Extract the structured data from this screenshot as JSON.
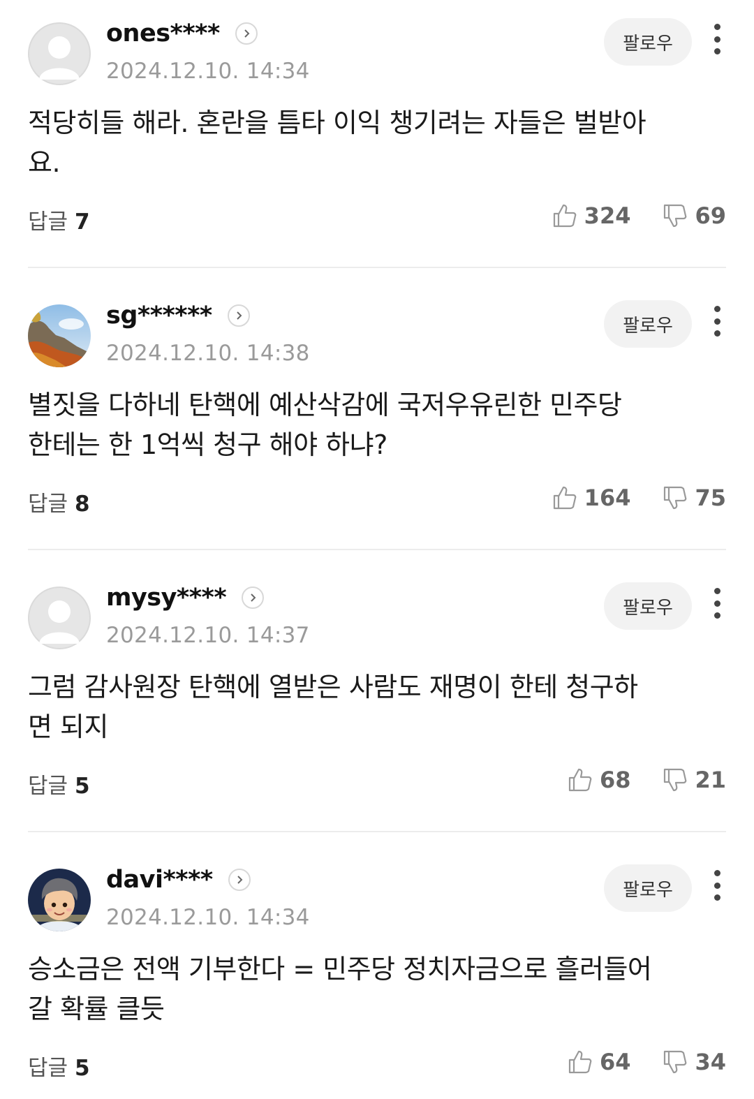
{
  "comments": [
    {
      "username": "ones****",
      "timestamp": "2024.12.10. 14:34",
      "follow_label": "팔로우",
      "body_lines": [
        "적당히들 해라. 혼란을 틈타 이익 챙기려는 자들은 벌받아",
        "요."
      ],
      "reply_label": "답글",
      "reply_count": "7",
      "likes": "324",
      "dislikes": "69",
      "avatar": "default-avatar"
    },
    {
      "username": "sg******",
      "timestamp": "2024.12.10. 14:38",
      "follow_label": "팔로우",
      "body_lines": [
        "별짓을 다하네 탄핵에 예산삭감에 국저우유린한 민주당",
        "한테는 한 1억씩 청구 해야 하냐?"
      ],
      "reply_label": "답글",
      "reply_count": "8",
      "likes": "164",
      "dislikes": "75",
      "avatar": "landscape-photo-avatar"
    },
    {
      "username": "mysy****",
      "timestamp": "2024.12.10. 14:37",
      "follow_label": "팔로우",
      "body_lines": [
        "그럼 감사원장 탄핵에 열받은 사람도 재명이 한테 청구하",
        "면 되지"
      ],
      "reply_label": "답글",
      "reply_count": "5",
      "likes": "68",
      "dislikes": "21",
      "avatar": "default-avatar"
    },
    {
      "username": "davi****",
      "timestamp": "2024.12.10. 14:34",
      "follow_label": "팔로우",
      "body_lines": [
        "승소금은 전액 기부한다 = 민주당 정치자금으로 흘러들어",
        "갈 확률 클듯"
      ],
      "reply_label": "답글",
      "reply_count": "5",
      "likes": "64",
      "dislikes": "34",
      "avatar": "cartoon-character-avatar"
    }
  ],
  "colors": {
    "username": "#111111",
    "timestamp": "#9a9a9a",
    "vote_count": "#666666",
    "follow_bg": "#f2f2f2",
    "divider": "#ececec"
  }
}
